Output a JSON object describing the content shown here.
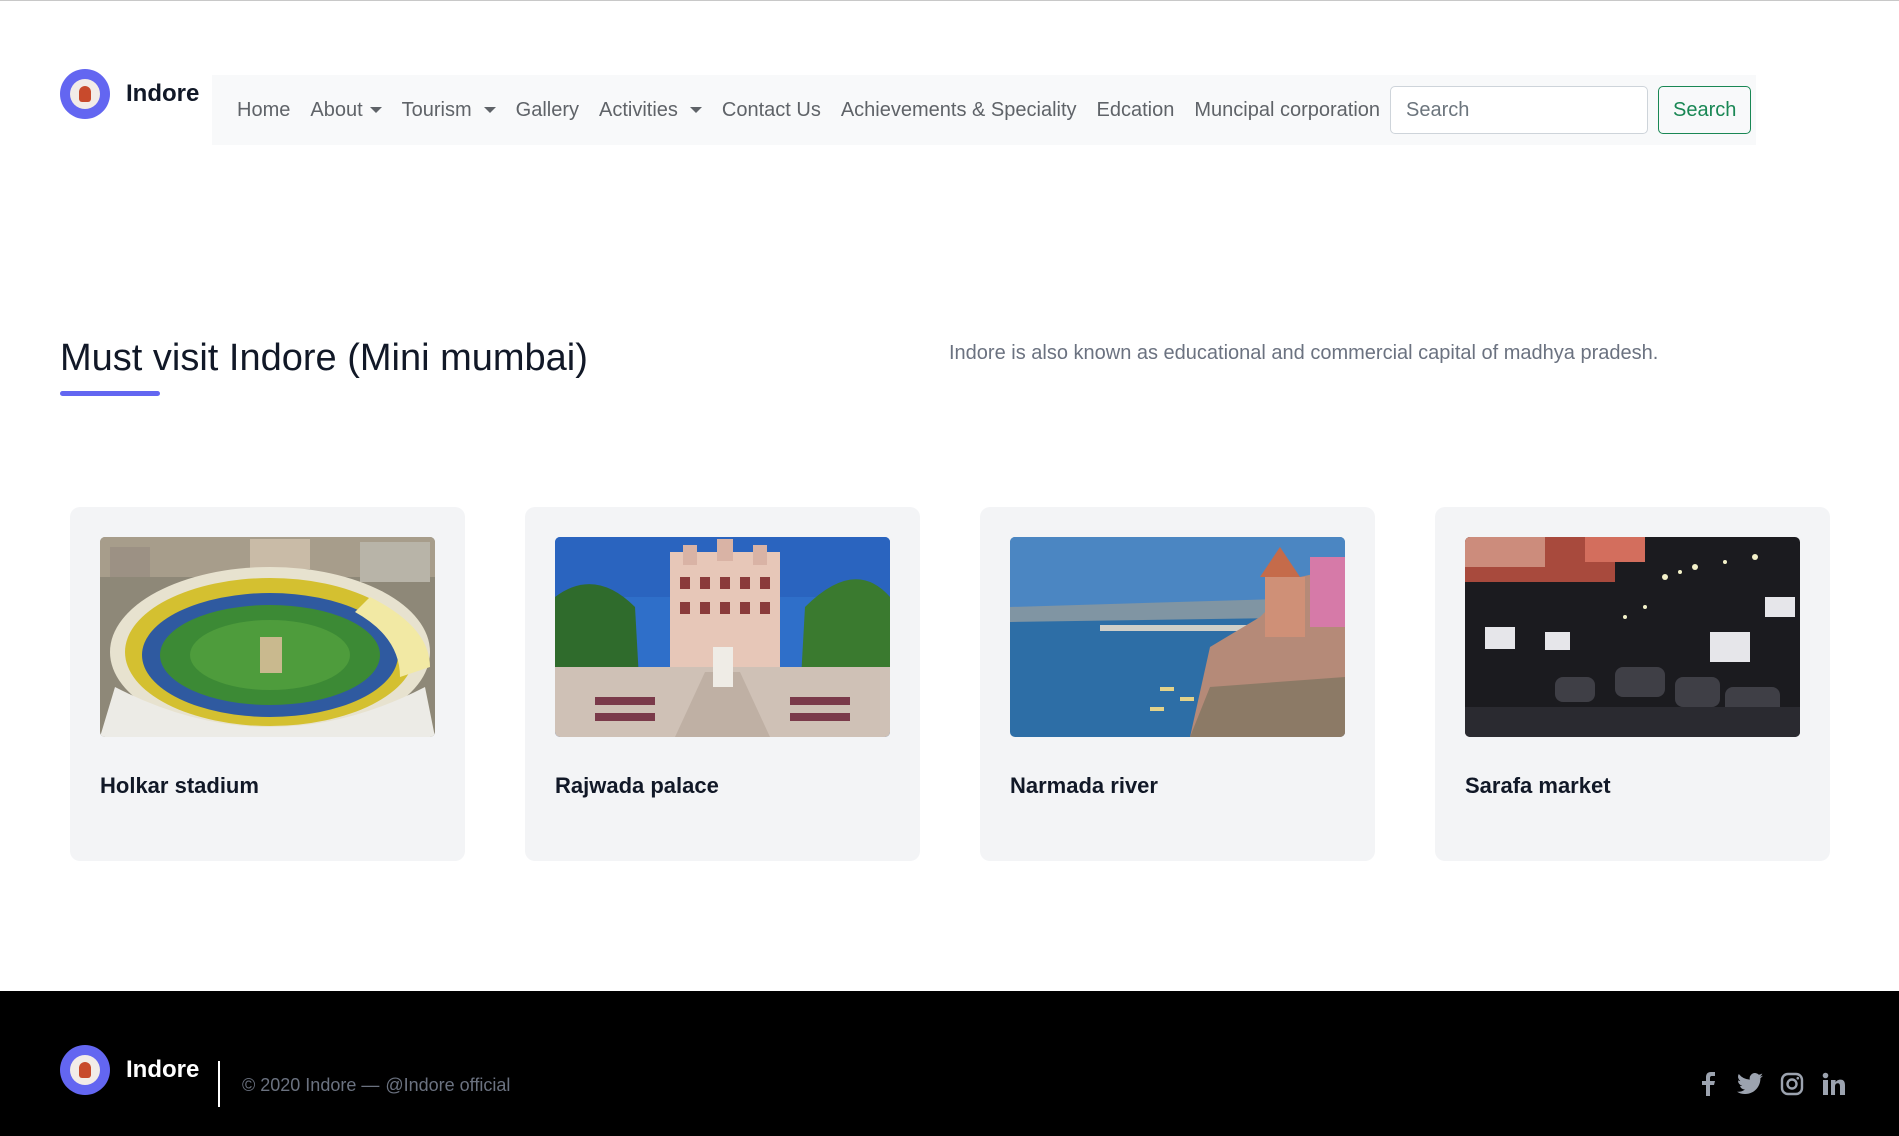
{
  "brand": {
    "name": "Indore",
    "logo_icon": "indore-logo-icon",
    "accent": "#6366f1"
  },
  "nav": {
    "items": [
      {
        "label": "Home",
        "dropdown": false
      },
      {
        "label": "About",
        "dropdown": true
      },
      {
        "label": "Tourism",
        "dropdown": true
      },
      {
        "label": "Gallery",
        "dropdown": false
      },
      {
        "label": "Activities",
        "dropdown": true
      },
      {
        "label": "Contact Us",
        "dropdown": false
      },
      {
        "label": "Achievements & Speciality",
        "dropdown": false
      },
      {
        "label": "Edcation",
        "dropdown": false
      },
      {
        "label": "Muncipal corporation",
        "dropdown": false
      }
    ],
    "search": {
      "placeholder": "Search",
      "button_label": "Search",
      "button_color": "#198754"
    }
  },
  "section": {
    "title": "Must visit Indore (Mini mumbai)",
    "tagline": "Indore is also known as educational and commercial capital of madhya pradesh."
  },
  "cards": [
    {
      "title": "Holkar stadium",
      "image": "stadium-photo"
    },
    {
      "title": "Rajwada palace",
      "image": "palace-photo"
    },
    {
      "title": "Narmada river",
      "image": "river-photo"
    },
    {
      "title": "Sarafa market",
      "image": "night-market-photo"
    }
  ],
  "footer": {
    "brand": "Indore",
    "copyright": "© 2020 Indore —",
    "handle": "@Indore official",
    "socials": [
      "facebook-icon",
      "twitter-icon",
      "instagram-icon",
      "linkedin-icon"
    ]
  }
}
